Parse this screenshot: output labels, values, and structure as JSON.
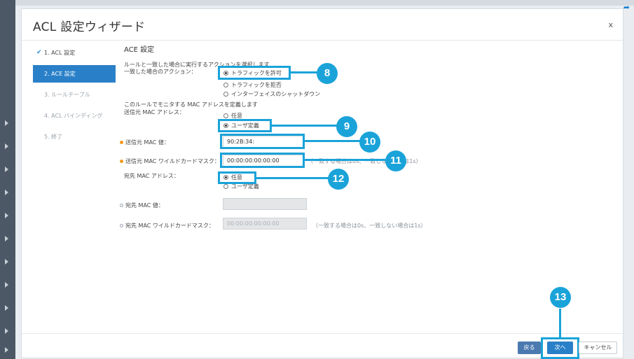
{
  "wizard": {
    "title": "ACL 設定ウィザード",
    "close_label": "x",
    "steps": [
      {
        "label": "1. ACL 設定",
        "status": "done"
      },
      {
        "label": "2. ACE 設定",
        "status": "active"
      },
      {
        "label": "3. ルールテーブル",
        "status": "pending"
      },
      {
        "label": "4. ACL バインディング",
        "status": "pending"
      },
      {
        "label": "5. 終了",
        "status": "pending"
      }
    ]
  },
  "ace": {
    "heading": "ACE 設定",
    "action_desc": "ルールと一致した場合に実行するアクションを選択します",
    "action_label": "一致した場合のアクション：",
    "action_options": [
      "トラフィックを許可",
      "トラフィックを拒否",
      "インターフェイスのシャットダウン"
    ],
    "mac_desc": "このルールでモニタする MAC アドレスを定義します",
    "src_mac_label": "送信元 MAC アドレス：",
    "src_mac_options": [
      "任意",
      "ユーザ定義"
    ],
    "src_mac_value_label": "送信元 MAC 値：",
    "src_mac_value": "90:2B:34:",
    "src_mask_label": "送信元 MAC ワイルドカードマスク：",
    "src_mask_value": "00:00:00:00:00:00",
    "src_mask_hint": "（一致する場合は0s、一致しない場合は1s）",
    "dst_mac_label": "宛先 MAC アドレス：",
    "dst_mac_options": [
      "任意",
      "ユーザ定義"
    ],
    "dst_mac_value_label": "宛先 MAC 値：",
    "dst_mask_label": "宛先 MAC ワイルドカードマスク：",
    "dst_mask_placeholder": "00:00:00:00:00:00",
    "dst_mask_hint": "（一致する場合は0s、一致しない場合は1s）"
  },
  "callouts": [
    "8",
    "9",
    "10",
    "11",
    "12",
    "13"
  ],
  "footer": {
    "back_label": "戻る",
    "next_label": "次へ",
    "cancel_label": "キャンセル"
  },
  "colors": {
    "accent": "#2a80c8",
    "callout": "#1aa3d9",
    "required": "#f39a1e"
  }
}
